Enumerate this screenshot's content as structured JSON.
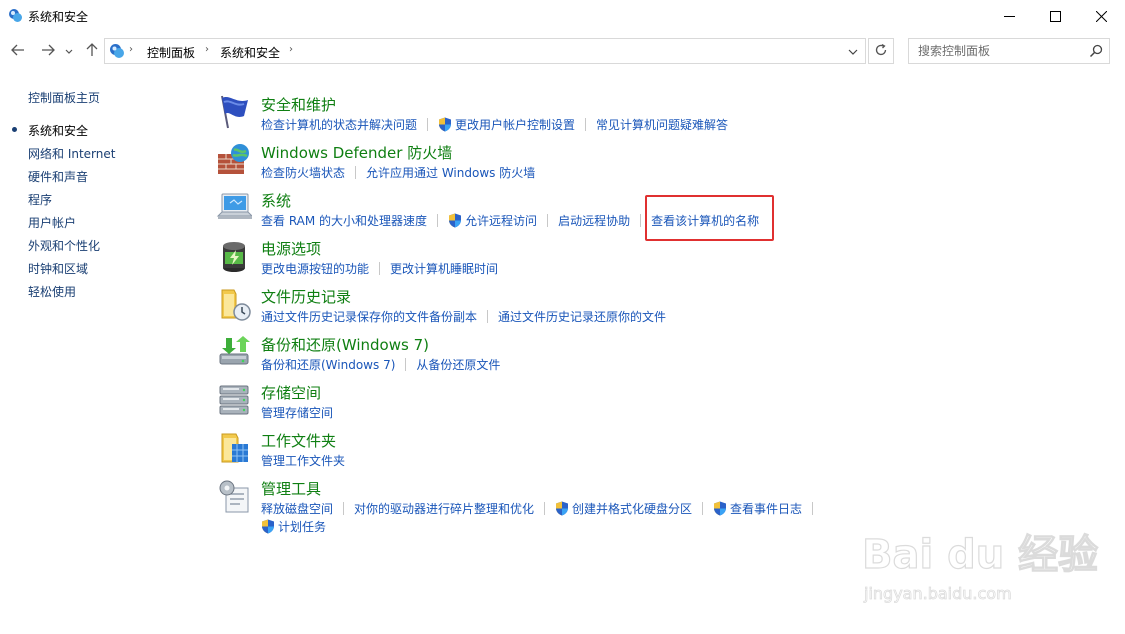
{
  "window": {
    "title": "系统和安全",
    "app_icon": "control-panel-icon",
    "controls": [
      "minimize-icon",
      "maximize-icon",
      "close-icon"
    ]
  },
  "navigation": {
    "back_icon": "arrow-left-icon",
    "forward_icon": "arrow-right-icon",
    "recent_icon": "chevron-down-icon",
    "up_icon": "arrow-up-icon",
    "breadcrumbs": [
      "控制面板",
      "系统和安全"
    ],
    "refresh_icon": "refresh-icon",
    "search": {
      "placeholder": "搜索控制面板",
      "value": ""
    }
  },
  "sidebar": {
    "items": [
      {
        "label": "控制面板主页",
        "active": false
      },
      {
        "label": "系统和安全",
        "active": true
      },
      {
        "label": "网络和 Internet",
        "active": false
      },
      {
        "label": "硬件和声音",
        "active": false
      },
      {
        "label": "程序",
        "active": false
      },
      {
        "label": "用户帐户",
        "active": false
      },
      {
        "label": "外观和个性化",
        "active": false
      },
      {
        "label": "时钟和区域",
        "active": false
      },
      {
        "label": "轻松使用",
        "active": false
      }
    ]
  },
  "sections": [
    {
      "title": "安全和维护",
      "icon": "flag-icon",
      "links": [
        {
          "label": "检查计算机的状态并解决问题",
          "shield": false
        },
        {
          "label": "更改用户帐户控制设置",
          "shield": true
        },
        {
          "label": "常见计算机问题疑难解答",
          "shield": false
        }
      ]
    },
    {
      "title": "Windows Defender 防火墙",
      "icon": "firewall-icon",
      "links": [
        {
          "label": "检查防火墙状态",
          "shield": false
        },
        {
          "label": "允许应用通过 Windows 防火墙",
          "shield": false
        }
      ]
    },
    {
      "title": "系统",
      "icon": "computer-icon",
      "links": [
        {
          "label": "查看 RAM 的大小和处理器速度",
          "shield": false
        },
        {
          "label": "允许远程访问",
          "shield": true
        },
        {
          "label": "启动远程协助",
          "shield": false
        },
        {
          "label": "查看该计算机的名称",
          "shield": false
        }
      ]
    },
    {
      "title": "电源选项",
      "icon": "battery-icon",
      "links": [
        {
          "label": "更改电源按钮的功能",
          "shield": false
        },
        {
          "label": "更改计算机睡眠时间",
          "shield": false
        }
      ]
    },
    {
      "title": "文件历史记录",
      "icon": "file-history-icon",
      "links": [
        {
          "label": "通过文件历史记录保存你的文件备份副本",
          "shield": false
        },
        {
          "label": "通过文件历史记录还原你的文件",
          "shield": false
        }
      ]
    },
    {
      "title": "备份和还原(Windows 7)",
      "icon": "backup-icon",
      "links": [
        {
          "label": "备份和还原(Windows 7)",
          "shield": false
        },
        {
          "label": "从备份还原文件",
          "shield": false
        }
      ]
    },
    {
      "title": "存储空间",
      "icon": "storage-icon",
      "links": [
        {
          "label": "管理存储空间",
          "shield": false
        }
      ]
    },
    {
      "title": "工作文件夹",
      "icon": "work-folders-icon",
      "links": [
        {
          "label": "管理工作文件夹",
          "shield": false
        }
      ]
    },
    {
      "title": "管理工具",
      "icon": "admin-tools-icon",
      "links": [
        {
          "label": "释放磁盘空间",
          "shield": false
        },
        {
          "label": "对你的驱动器进行碎片整理和优化",
          "shield": false
        },
        {
          "label": "创建并格式化硬盘分区",
          "shield": true
        },
        {
          "label": "查看事件日志",
          "shield": true
        }
      ],
      "links2": [
        {
          "label": "计划任务",
          "shield": true
        }
      ]
    }
  ],
  "annotation": {
    "highlight_color": "#e03030",
    "highlighted_link": "查看该计算机的名称"
  },
  "watermark": {
    "main": "Bai du 经验",
    "sub": "jingyan.baidu.com"
  },
  "colors": {
    "link": "#1a56b9",
    "section_title": "#0f7f12",
    "sidebar_link": "#1a3f73"
  }
}
